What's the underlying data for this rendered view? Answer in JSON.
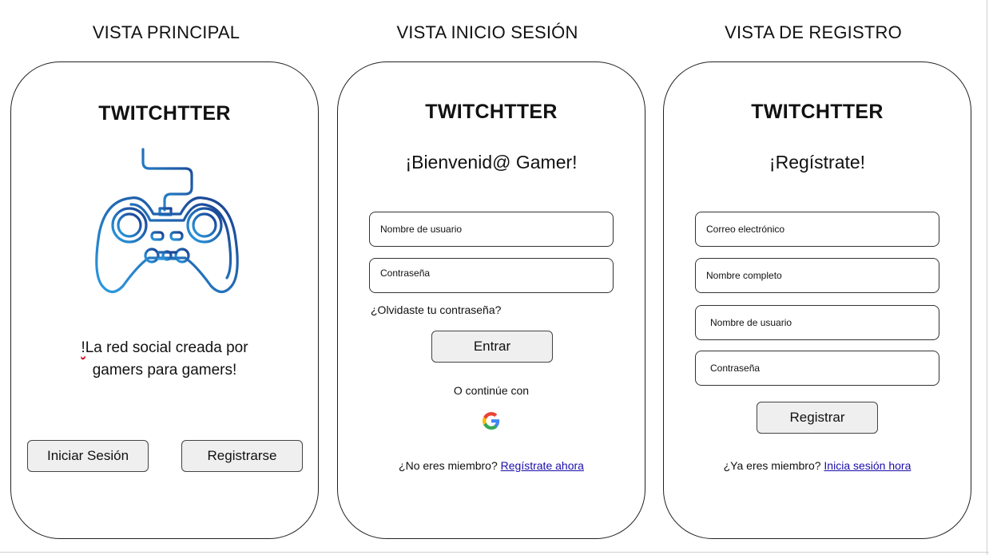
{
  "views": {
    "main": {
      "title": "VISTA PRINCIPAL",
      "brand": "TWITCHTTER",
      "icon": "gamepad-icon",
      "tagline_mark": "!",
      "tagline_line1": "La red social creada por",
      "tagline_line2": "gamers para gamers!",
      "login_button": "Iniciar Sesión",
      "register_button": "Registrarse"
    },
    "login": {
      "title": "VISTA INICIO SESIÓN",
      "brand": "TWITCHTTER",
      "welcome": "¡Bienvenid@ Gamer!",
      "username_placeholder": "Nombre de usuario",
      "password_placeholder": "Contraseña",
      "forgot": "¿Olvidaste tu contraseña?",
      "submit": "Entrar",
      "continue_with": "O continúe con",
      "google_icon": "google-icon",
      "not_member": "¿No eres miembro?",
      "register_link": "Regístrate ahora"
    },
    "register": {
      "title": "VISTA DE REGISTRO",
      "brand": "TWITCHTTER",
      "welcome": "¡Regístrate!",
      "email_placeholder": "Correo electrónico",
      "fullname_placeholder": "Nombre completo",
      "username_placeholder": "Nombre de usuario",
      "password_placeholder": "Contraseña",
      "submit": "Registrar",
      "already_member": "¿Ya eres miembro?",
      "login_link": "Inicia sesión hora"
    }
  },
  "colors": {
    "link": "#1a0dab",
    "button_bg": "#efefef",
    "gamepad_dark": "#1a3f8f",
    "gamepad_light": "#2a9be0"
  }
}
